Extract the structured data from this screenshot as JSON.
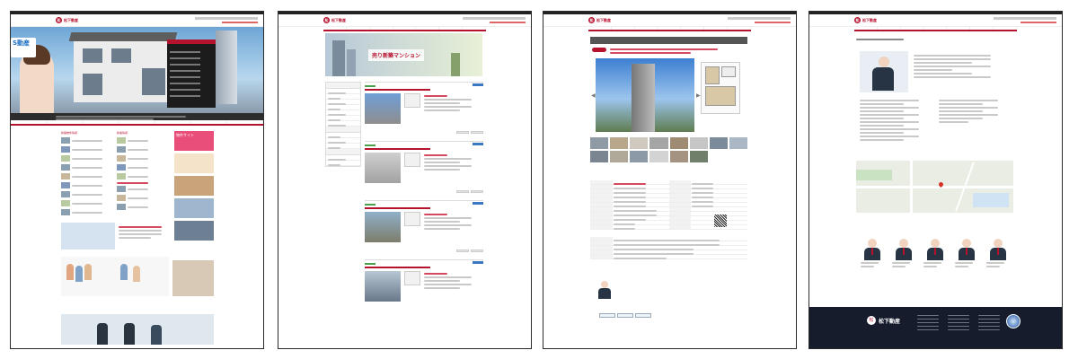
{
  "brand": {
    "name": "松下動産",
    "mark": "松",
    "color": "#b5122e"
  },
  "screens": [
    {
      "id": "top",
      "hero_sign": "S動産",
      "sections": [
        "新着物件情報",
        "新着情報"
      ],
      "banner_text": "物件サイト"
    },
    {
      "id": "list",
      "hero_title": "売り新築マンション"
    },
    {
      "id": "detail"
    },
    {
      "id": "company",
      "footer_brand": "松下動産"
    }
  ],
  "colors": {
    "accent": "#b5122e",
    "footer_bg": "#161c2c",
    "link_blue": "#3b78c2",
    "tag_green": "#4aa14a"
  },
  "icons": [
    "logo-mark-icon",
    "map-pin-icon",
    "qr-code-icon",
    "seal-icon",
    "arrow-left-icon",
    "arrow-right-icon"
  ]
}
